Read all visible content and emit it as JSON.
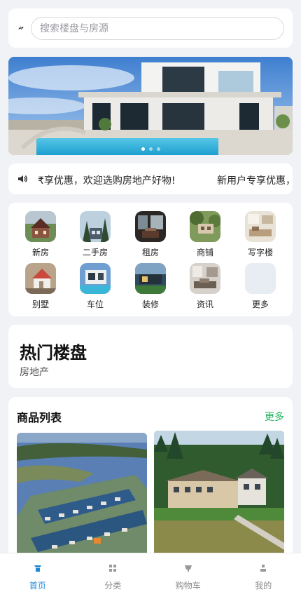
{
  "search": {
    "placeholder": "搜索楼盘与房源",
    "value": ""
  },
  "banner": {
    "slides": 3,
    "active_slide": 0
  },
  "notice": {
    "text_1": "₹享优惠，欢迎选购房地产好物!",
    "text_2": "新用户专享优惠，"
  },
  "categories": [
    {
      "label": "新房",
      "icon": "new-house"
    },
    {
      "label": "二手房",
      "icon": "second-hand-house"
    },
    {
      "label": "租房",
      "icon": "rental"
    },
    {
      "label": "商铺",
      "icon": "shop"
    },
    {
      "label": "写字楼",
      "icon": "office"
    },
    {
      "label": "别墅",
      "icon": "villa"
    },
    {
      "label": "车位",
      "icon": "parking"
    },
    {
      "label": "装修",
      "icon": "decoration"
    },
    {
      "label": "资讯",
      "icon": "news"
    },
    {
      "label": "更多",
      "icon": "more"
    }
  ],
  "hot": {
    "title": "热门楼盘",
    "subtitle": "房地产"
  },
  "products": {
    "title": "商品列表",
    "more": "更多"
  },
  "tabbar": [
    {
      "label": "首页",
      "icon": "home-icon",
      "active": true
    },
    {
      "label": "分类",
      "icon": "grid-icon",
      "active": false
    },
    {
      "label": "购物车",
      "icon": "cart-icon",
      "active": false
    },
    {
      "label": "我的",
      "icon": "user-icon",
      "active": false
    }
  ],
  "colors": {
    "accent": "#1e88d6",
    "more": "#20b45a",
    "background": "#f1f2f6"
  }
}
